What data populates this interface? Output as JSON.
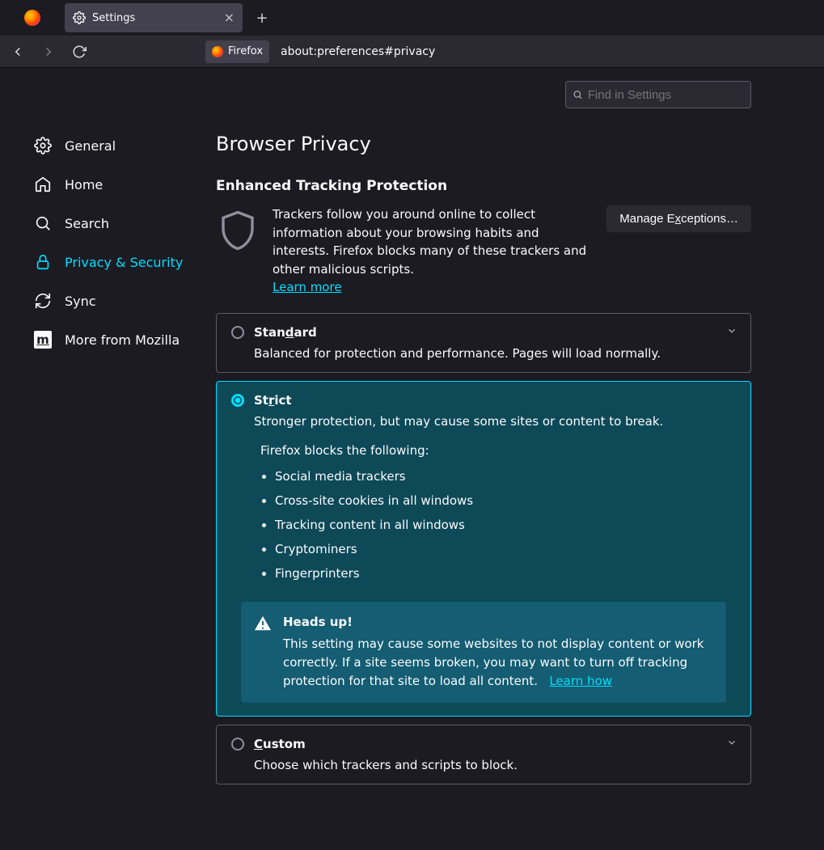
{
  "tab": {
    "title": "Settings"
  },
  "urlbar": {
    "badge": "Firefox",
    "url": "about:preferences#privacy"
  },
  "search": {
    "placeholder": "Find in Settings"
  },
  "sidebar": {
    "items": [
      {
        "label": "General"
      },
      {
        "label": "Home"
      },
      {
        "label": "Search"
      },
      {
        "label": "Privacy & Security"
      },
      {
        "label": "Sync"
      },
      {
        "label": "More from Mozilla"
      }
    ]
  },
  "page": {
    "title": "Browser Privacy",
    "section": "Enhanced Tracking Protection",
    "etp_desc": "Trackers follow you around online to collect information about your browsing habits and interests. Firefox blocks many of these trackers and other malicious scripts.",
    "learn_more": "Learn more",
    "manage_pre": "Manage E",
    "manage_u": "x",
    "manage_post": "ceptions…"
  },
  "standard": {
    "title_pre": "Stan",
    "title_u": "d",
    "title_post": "ard",
    "desc": "Balanced for protection and performance. Pages will load normally."
  },
  "strict": {
    "title_pre": "St",
    "title_u": "r",
    "title_post": "ict",
    "desc": "Stronger protection, but may cause some sites or content to break.",
    "blocks_heading": "Firefox blocks the following:",
    "blocks": [
      "Social media trackers",
      "Cross-site cookies in all windows",
      "Tracking content in all windows",
      "Cryptominers",
      "Fingerprinters"
    ],
    "headsup_title": "Heads up!",
    "headsup_body": "This setting may cause some websites to not display content or work correctly. If a site seems broken, you may want to turn off tracking protection for that site to load all content.",
    "learn_how": "Learn how"
  },
  "custom": {
    "title_u": "C",
    "title_post": "ustom",
    "desc": "Choose which trackers and scripts to block."
  }
}
